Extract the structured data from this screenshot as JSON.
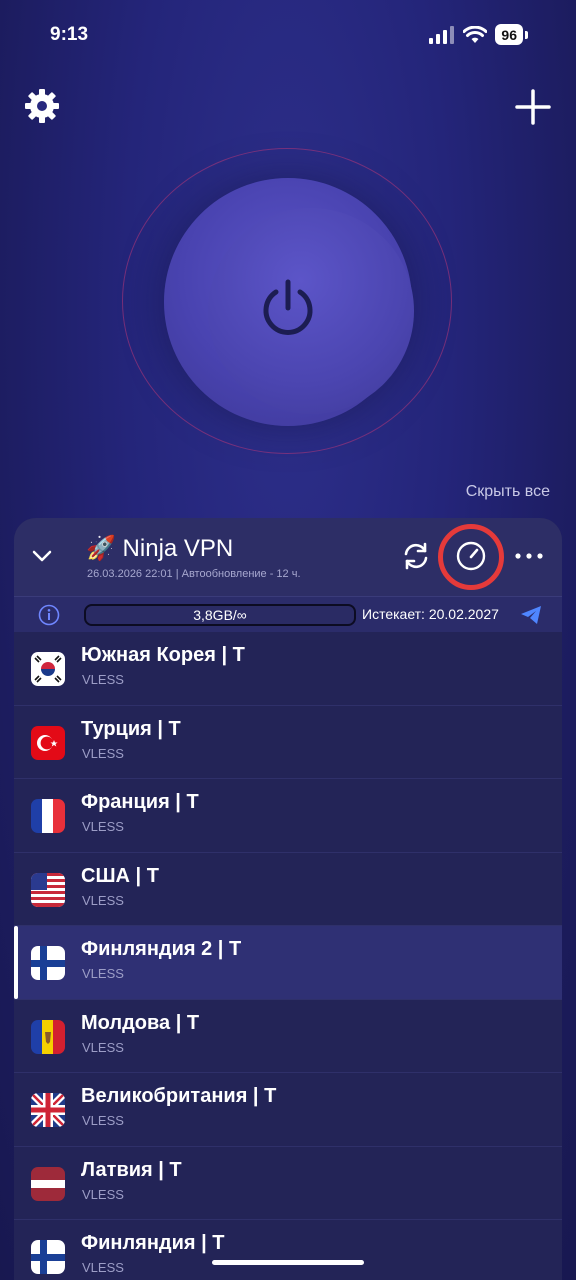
{
  "status_bar": {
    "time": "9:13",
    "battery": "96"
  },
  "main": {
    "hide_all": "Скрыть все"
  },
  "provider": {
    "title": "🚀 Ninja VPN",
    "subtitle": "26.03.2026 22:01 | Автообновление - 12 ч.",
    "usage": "3,8GB/∞",
    "expiry": "Истекает: 20.02.2027"
  },
  "servers": [
    {
      "name": "Южная Корея | T",
      "protocol": "VLESS",
      "flag": "south-korea"
    },
    {
      "name": "Турция | T",
      "protocol": "VLESS",
      "flag": "turkey"
    },
    {
      "name": "Франция | T",
      "protocol": "VLESS",
      "flag": "france"
    },
    {
      "name": "США | T",
      "protocol": "VLESS",
      "flag": "usa"
    },
    {
      "name": "Финляндия 2 | T",
      "protocol": "VLESS",
      "flag": "finland",
      "active": true
    },
    {
      "name": "Молдова | T",
      "protocol": "VLESS",
      "flag": "moldova"
    },
    {
      "name": "Великобритания | T",
      "protocol": "VLESS",
      "flag": "uk"
    },
    {
      "name": "Латвия | T",
      "protocol": "VLESS",
      "flag": "latvia"
    },
    {
      "name": "Финляндия | T",
      "protocol": "VLESS",
      "flag": "finland"
    }
  ],
  "colors": {
    "accent_ring": "#e53a3a",
    "power_button": "#4b45b0",
    "panel": "#232457"
  }
}
